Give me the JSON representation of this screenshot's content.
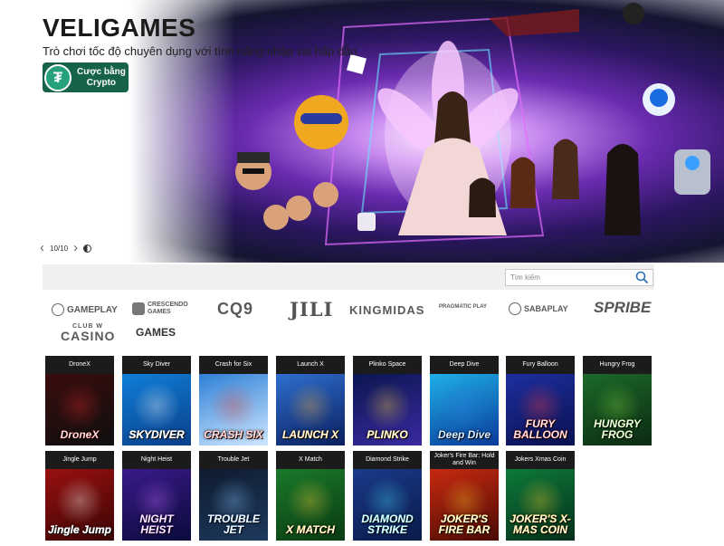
{
  "hero": {
    "title": "VELIGAMES",
    "subtitle": "Trò chơi tốc độ chuyên dụng với tính năng nhập vai hấp dẫn",
    "crypto_badge": {
      "icon": "tether-icon",
      "line1": "Cược bằng",
      "line2": "Crypto",
      "color": "#17624b"
    },
    "slider": {
      "counter": "10/10"
    }
  },
  "search": {
    "placeholder": "Tìm kiếm",
    "icon": "search-icon"
  },
  "providers": {
    "gameplay": "GAMEPLAY",
    "crescendo_line1": "CRESCENDO",
    "crescendo_line2": "GAMES",
    "cq9": "CQ9",
    "jili": "JILI",
    "kingmidas": "KINGMIDAS",
    "pragmatic": "PRAGMATIC PLAY",
    "sabaplay": "SABAPLAY",
    "spribe": "SPRIBE",
    "clubw_small": "CLUB W",
    "clubw_big": "CASINO",
    "vgames": "GAMES"
  },
  "games": [
    {
      "title": "DroneX",
      "logo": "DroneX",
      "bg": [
        "#3a0c0c",
        "#0f0f0f"
      ],
      "accent": "#e0282a"
    },
    {
      "title": "Sky Diver",
      "logo": "SKYDIVER",
      "bg": [
        "#0f7fd8",
        "#0a3f8a"
      ],
      "accent": "#ffffff"
    },
    {
      "title": "Crash for Six",
      "logo": "CRASH SIX",
      "bg": [
        "#2d7fd6",
        "#cfe7ff"
      ],
      "accent": "#e33b2e"
    },
    {
      "title": "Launch X",
      "logo": "LAUNCH X",
      "bg": [
        "#2f6fd0",
        "#0a1f5e"
      ],
      "accent": "#ffb93a"
    },
    {
      "title": "Plinko Space",
      "logo": "PLINKO",
      "bg": [
        "#0a1650",
        "#3a2aa0"
      ],
      "accent": "#ffd23a"
    },
    {
      "title": "Deep Dive",
      "logo": "Deep Dive",
      "bg": [
        "#1fb0e8",
        "#0a3a9a"
      ],
      "accent": "#2a7ee0"
    },
    {
      "title": "Fury Balloon",
      "logo": "FURY BALLOON",
      "bg": [
        "#1e2fa0",
        "#0a1050"
      ],
      "accent": "#ff3a3a"
    },
    {
      "title": "Hungry Frog",
      "logo": "HUNGRY FROG",
      "bg": [
        "#1d6a2a",
        "#0b2a12"
      ],
      "accent": "#7bd23a"
    },
    {
      "title": "Jingle Jump",
      "logo": "Jingle Jump",
      "bg": [
        "#9a1010",
        "#3a0505"
      ],
      "accent": "#ffffff"
    },
    {
      "title": "Night Heist",
      "logo": "NIGHT HEIST",
      "bg": [
        "#3a1a8a",
        "#0a0a3a"
      ],
      "accent": "#c06bff"
    },
    {
      "title": "Trouble Jet",
      "logo": "TROUBLE JET",
      "bg": [
        "#0e1a2e",
        "#1e3a5e"
      ],
      "accent": "#8ac4ff"
    },
    {
      "title": "X Match",
      "logo": "X MATCH",
      "bg": [
        "#1a7a2a",
        "#0a3a12"
      ],
      "accent": "#ffd23a"
    },
    {
      "title": "Diamond Strike",
      "logo": "DIAMOND STRIKE",
      "bg": [
        "#1a3a8a",
        "#0a1a4a"
      ],
      "accent": "#4ae0ff"
    },
    {
      "title": "Joker's Fire Bar: Hold and Win",
      "logo": "JOKER'S FIRE BAR",
      "bg": [
        "#c82a10",
        "#4a0a05"
      ],
      "accent": "#ffcc2a"
    },
    {
      "title": "Jokers Xmas Coin",
      "logo": "JOKER'S X-MAS COIN",
      "bg": [
        "#0d7a3a",
        "#05301a"
      ],
      "accent": "#ffcc2a"
    }
  ]
}
